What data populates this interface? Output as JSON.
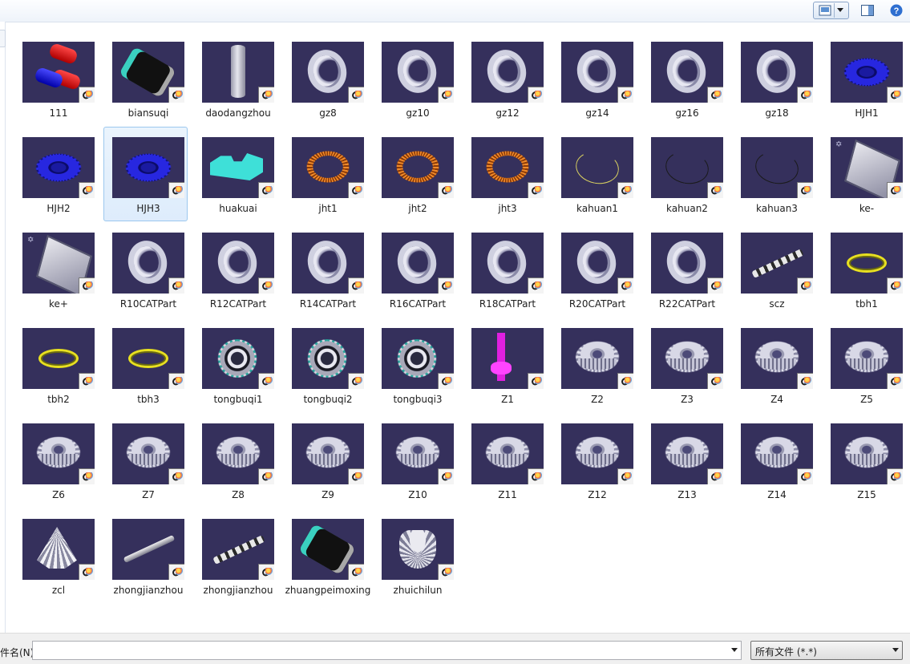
{
  "toolbar": {
    "view_icon": "view-thumbnails-icon",
    "preview_icon": "preview-pane-icon",
    "help_icon": "help-icon"
  },
  "files": [
    {
      "name": "111",
      "art": "redblue"
    },
    {
      "name": "biansuqi",
      "art": "mechdark"
    },
    {
      "name": "daodangzhou",
      "art": "cyl"
    },
    {
      "name": "gz8",
      "art": "ring"
    },
    {
      "name": "gz10",
      "art": "ring"
    },
    {
      "name": "gz12",
      "art": "ring"
    },
    {
      "name": "gz14",
      "art": "ring"
    },
    {
      "name": "gz16",
      "art": "ring"
    },
    {
      "name": "gz18",
      "art": "ring"
    },
    {
      "name": "HJH1",
      "art": "gear-blue"
    },
    {
      "name": "HJH2",
      "art": "gear-blue"
    },
    {
      "name": "HJH3",
      "art": "gear-blue"
    },
    {
      "name": "huakuai",
      "art": "teal"
    },
    {
      "name": "jht1",
      "art": "gear-orange"
    },
    {
      "name": "jht2",
      "art": "gear-orange"
    },
    {
      "name": "jht3",
      "art": "gear-orange"
    },
    {
      "name": "kahuan1",
      "art": "wire"
    },
    {
      "name": "kahuan2",
      "art": "wire-dark"
    },
    {
      "name": "kahuan3",
      "art": "wire-dark"
    },
    {
      "name": "ke-",
      "art": "cover"
    },
    {
      "name": "ke+",
      "art": "cover"
    },
    {
      "name": "R10CATPart",
      "art": "ring"
    },
    {
      "name": "R12CATPart",
      "art": "ring"
    },
    {
      "name": "R14CATPart",
      "art": "ring"
    },
    {
      "name": "R16CATPart",
      "art": "ring"
    },
    {
      "name": "R18CATPart",
      "art": "ring"
    },
    {
      "name": "R20CATPart",
      "art": "ring"
    },
    {
      "name": "R22CATPart",
      "art": "ring"
    },
    {
      "name": "scz",
      "art": "shaft-dark"
    },
    {
      "name": "tbh1",
      "art": "gear-yellow"
    },
    {
      "name": "tbh2",
      "art": "gear-yellow"
    },
    {
      "name": "tbh3",
      "art": "gear-yellow"
    },
    {
      "name": "tongbuqi1",
      "art": "syncring"
    },
    {
      "name": "tongbuqi2",
      "art": "syncring"
    },
    {
      "name": "tongbuqi3",
      "art": "syncring"
    },
    {
      "name": "Z1",
      "art": "pink"
    },
    {
      "name": "Z2",
      "art": "gear-grey"
    },
    {
      "name": "Z3",
      "art": "gear-grey"
    },
    {
      "name": "Z4",
      "art": "gear-grey"
    },
    {
      "name": "Z5",
      "art": "gear-grey"
    },
    {
      "name": "Z6",
      "art": "gear-grey"
    },
    {
      "name": "Z7",
      "art": "gear-grey"
    },
    {
      "name": "Z8",
      "art": "gear-grey"
    },
    {
      "name": "Z9",
      "art": "gear-grey"
    },
    {
      "name": "Z10",
      "art": "gear-grey"
    },
    {
      "name": "Z11",
      "art": "gear-grey"
    },
    {
      "name": "Z12",
      "art": "gear-grey"
    },
    {
      "name": "Z13",
      "art": "gear-grey"
    },
    {
      "name": "Z14",
      "art": "gear-grey"
    },
    {
      "name": "Z15",
      "art": "gear-grey"
    },
    {
      "name": "zcl",
      "art": "cone"
    },
    {
      "name": "zhongjianzhou",
      "art": "shaft"
    },
    {
      "name": "zhongjianzhou",
      "art": "shaft-dark"
    },
    {
      "name": "zhuangpeimoxing",
      "art": "mechdark"
    },
    {
      "name": "zhuichilun",
      "art": "hub"
    }
  ],
  "selected_index": 11,
  "footer": {
    "filename_label": "件名(N):",
    "filename_value": "",
    "filetype_value": "所有文件 (*.*)"
  },
  "colors": {
    "thumb_bg": "#35305c",
    "selection": "#cce4fa"
  }
}
